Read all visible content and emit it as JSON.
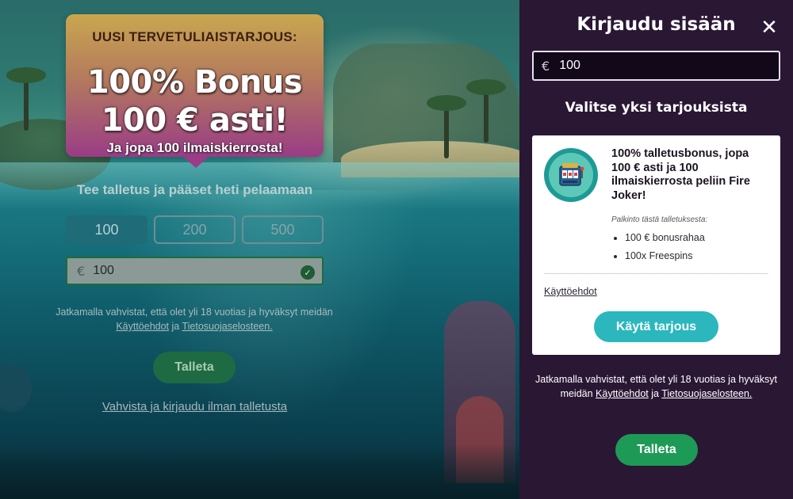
{
  "promo": {
    "kicker": "UUSI TERVETULIAISTARJOUS:",
    "headline_line1": "100% Bonus",
    "headline_line2": "100 € asti!",
    "subline": "Ja jopa 100 ilmaiskierrosta!"
  },
  "deposit": {
    "title": "Tee talletus ja pääset heti pelaamaan",
    "amounts": [
      "100",
      "200",
      "500"
    ],
    "selected_amount": "100",
    "currency_symbol": "€",
    "field_value": "100",
    "consent_prefix": "Jatkamalla vahvistat, että olet yli 18 vuotias ja hyväksyt meidän ",
    "terms_link": "Käyttöehdot",
    "consent_and": " ja ",
    "privacy_link": "Tietosuojaselosteen.",
    "deposit_button": "Talleta",
    "skip_link": "Vahvista ja kirjaudu ilman talletusta"
  },
  "panel": {
    "title": "Kirjaudu sisään",
    "close_icon": "close-icon",
    "currency_symbol": "€",
    "amount_value": "100",
    "offers_title": "Valitse yksi tarjouksista",
    "offer": {
      "icon": "slot-machine-icon",
      "headline": "100% talletusbonus, jopa 100 € asti ja 100 ilmaiskierrosta peliin Fire Joker!",
      "reward_label": "Palkinto tästä talletuksesta:",
      "rewards": [
        "100 € bonusrahaa",
        "100x Freespins"
      ],
      "terms_link": "Käyttöehdot",
      "use_button": "Käytä tarjous"
    },
    "consent_prefix": "Jatkamalla vahvistat, että olet yli 18 vuotias ja hyväksyt meidän ",
    "terms_link": "Käyttöehdot",
    "consent_and": " ja ",
    "privacy_link": "Tietosuojaselosteen.",
    "deposit_button": "Talleta"
  },
  "colors": {
    "panel_bg": "#2a1734",
    "accent_teal": "#2bb7bd",
    "deposit_green": "#1e9a57"
  }
}
